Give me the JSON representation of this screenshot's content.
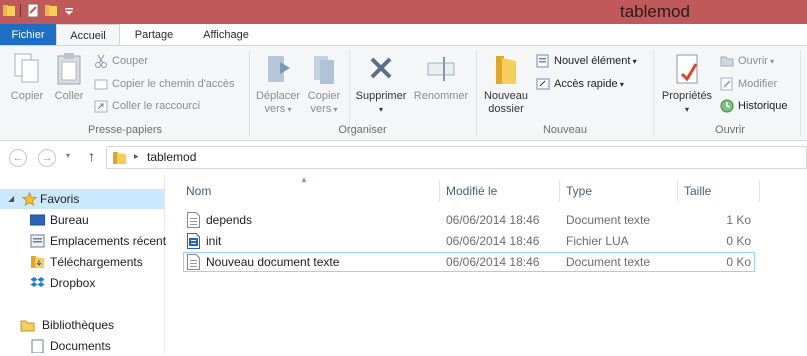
{
  "window": {
    "title": "tablemod"
  },
  "tabs": [
    {
      "label": "Fichier"
    },
    {
      "label": "Accueil"
    },
    {
      "label": "Partage"
    },
    {
      "label": "Affichage"
    }
  ],
  "ribbon": {
    "clipboard": {
      "copier": "Copier",
      "coller": "Coller",
      "couper": "Couper",
      "copier_chemin": "Copier le chemin d'accès",
      "coller_raccourci": "Coller le raccourci",
      "group_label": "Presse-papiers"
    },
    "organiser": {
      "deplacer_1": "Déplacer",
      "deplacer_2": "vers",
      "copier_1": "Copier",
      "copier_2": "vers",
      "supprimer": "Supprimer",
      "renommer": "Renommer",
      "group_label": "Organiser"
    },
    "nouveau": {
      "nouveau_dossier_1": "Nouveau",
      "nouveau_dossier_2": "dossier",
      "nouvel_element": "Nouvel élément",
      "acces_rapide": "Accès rapide",
      "group_label": "Nouveau"
    },
    "ouvrir": {
      "proprietes": "Propriétés",
      "ouvrir": "Ouvrir",
      "modifier": "Modifier",
      "historique": "Historique",
      "group_label": "Ouvrir"
    }
  },
  "address": {
    "crumb": "tablemod"
  },
  "nav": {
    "favoris": "Favoris",
    "bureau": "Bureau",
    "emplacements": "Emplacements récent",
    "telechargements": "Téléchargements",
    "dropbox": "Dropbox",
    "bibliotheques": "Bibliothèques",
    "documents": "Documents"
  },
  "columns": {
    "name": "Nom",
    "modified": "Modifié le",
    "type": "Type",
    "size": "Taille"
  },
  "files": [
    {
      "name": "depends",
      "modified": "06/06/2014 18:46",
      "type": "Document texte",
      "size": "1 Ko"
    },
    {
      "name": "init",
      "modified": "06/06/2014 18:46",
      "type": "Fichier LUA",
      "size": "0 Ko"
    },
    {
      "name": "Nouveau document texte",
      "modified": "06/06/2014 18:46",
      "type": "Document texte",
      "size": "0 Ko"
    }
  ],
  "colors": {
    "title_bar": "#c05a5a",
    "file_tab": "#1e6fc4",
    "selection": "#99d1ff"
  }
}
